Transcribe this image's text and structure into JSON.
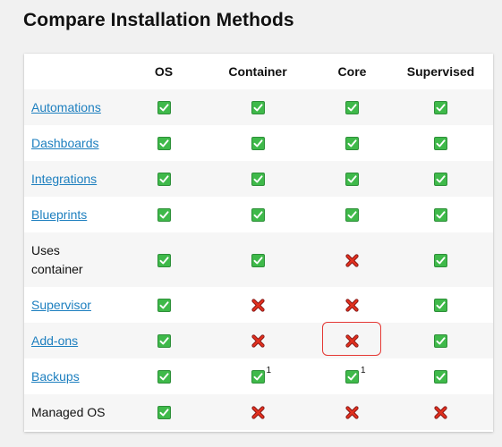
{
  "page": {
    "title": "Compare Installation Methods"
  },
  "table": {
    "headers": [
      "",
      "OS",
      "Container",
      "Core",
      "Supervised"
    ],
    "rows": [
      {
        "feature": "Automations",
        "link": true,
        "cells": [
          {
            "s": "yes"
          },
          {
            "s": "yes"
          },
          {
            "s": "yes"
          },
          {
            "s": "yes"
          }
        ]
      },
      {
        "feature": "Dashboards",
        "link": true,
        "cells": [
          {
            "s": "yes"
          },
          {
            "s": "yes"
          },
          {
            "s": "yes"
          },
          {
            "s": "yes"
          }
        ]
      },
      {
        "feature": "Integrations",
        "link": true,
        "cells": [
          {
            "s": "yes"
          },
          {
            "s": "yes"
          },
          {
            "s": "yes"
          },
          {
            "s": "yes"
          }
        ]
      },
      {
        "feature": "Blueprints",
        "link": true,
        "cells": [
          {
            "s": "yes"
          },
          {
            "s": "yes"
          },
          {
            "s": "yes"
          },
          {
            "s": "yes"
          }
        ]
      },
      {
        "feature": "Uses\ncontainer",
        "link": false,
        "tall": true,
        "cells": [
          {
            "s": "yes"
          },
          {
            "s": "yes"
          },
          {
            "s": "no"
          },
          {
            "s": "yes"
          }
        ]
      },
      {
        "feature": "Supervisor",
        "link": true,
        "cells": [
          {
            "s": "yes"
          },
          {
            "s": "no"
          },
          {
            "s": "no"
          },
          {
            "s": "yes"
          }
        ]
      },
      {
        "feature": "Add-ons",
        "link": true,
        "cells": [
          {
            "s": "yes"
          },
          {
            "s": "no"
          },
          {
            "s": "no"
          },
          {
            "s": "yes"
          }
        ]
      },
      {
        "feature": "Backups",
        "link": true,
        "cells": [
          {
            "s": "yes"
          },
          {
            "s": "yes",
            "note": "1"
          },
          {
            "s": "yes",
            "note": "1"
          },
          {
            "s": "yes"
          }
        ]
      },
      {
        "feature": "Managed OS",
        "link": false,
        "cells": [
          {
            "s": "yes"
          },
          {
            "s": "no"
          },
          {
            "s": "no"
          },
          {
            "s": "no"
          }
        ]
      }
    ]
  },
  "icons": {
    "yes": "check-mark-icon",
    "no": "cross-mark-icon"
  },
  "colors": {
    "link": "#1d7fbf",
    "check": "#3fb94a",
    "cross": "#d32f2f",
    "highlight": "#e53935"
  }
}
